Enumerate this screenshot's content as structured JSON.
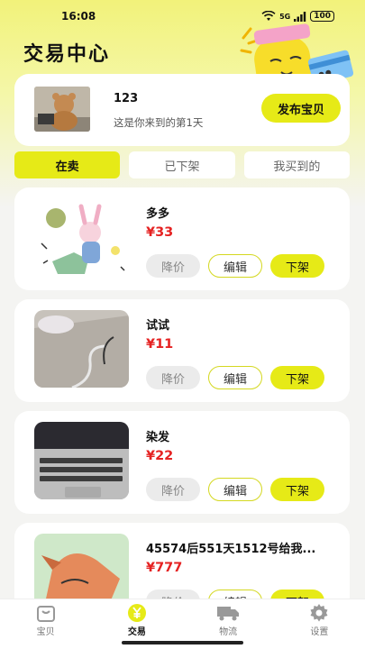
{
  "status_bar": {
    "time": "16:08",
    "network": "5G",
    "battery": "100"
  },
  "page_title": "交易中心",
  "profile": {
    "username": "123",
    "days_text": "这是你来到的第1天",
    "publish_label": "发布宝贝"
  },
  "tabs": [
    {
      "label": "在卖",
      "active": true
    },
    {
      "label": "已下架",
      "active": false
    },
    {
      "label": "我买到的",
      "active": false
    }
  ],
  "items": [
    {
      "title": "多多",
      "price": "¥33"
    },
    {
      "title": "试试",
      "price": "¥11"
    },
    {
      "title": "染发",
      "price": "¥22"
    },
    {
      "title": "45574后551天1512号给我...",
      "price": "¥777"
    }
  ],
  "item_actions": {
    "lower_price": "降价",
    "edit": "编辑",
    "take_down": "下架"
  },
  "bottom_nav": [
    {
      "label": "宝贝",
      "icon": "bag-icon",
      "active": false
    },
    {
      "label": "交易",
      "icon": "yuan-icon",
      "active": true
    },
    {
      "label": "物流",
      "icon": "truck-icon",
      "active": false
    },
    {
      "label": "设置",
      "icon": "gear-icon",
      "active": false
    }
  ],
  "colors": {
    "accent": "#e6ea17",
    "price": "#e52222"
  }
}
